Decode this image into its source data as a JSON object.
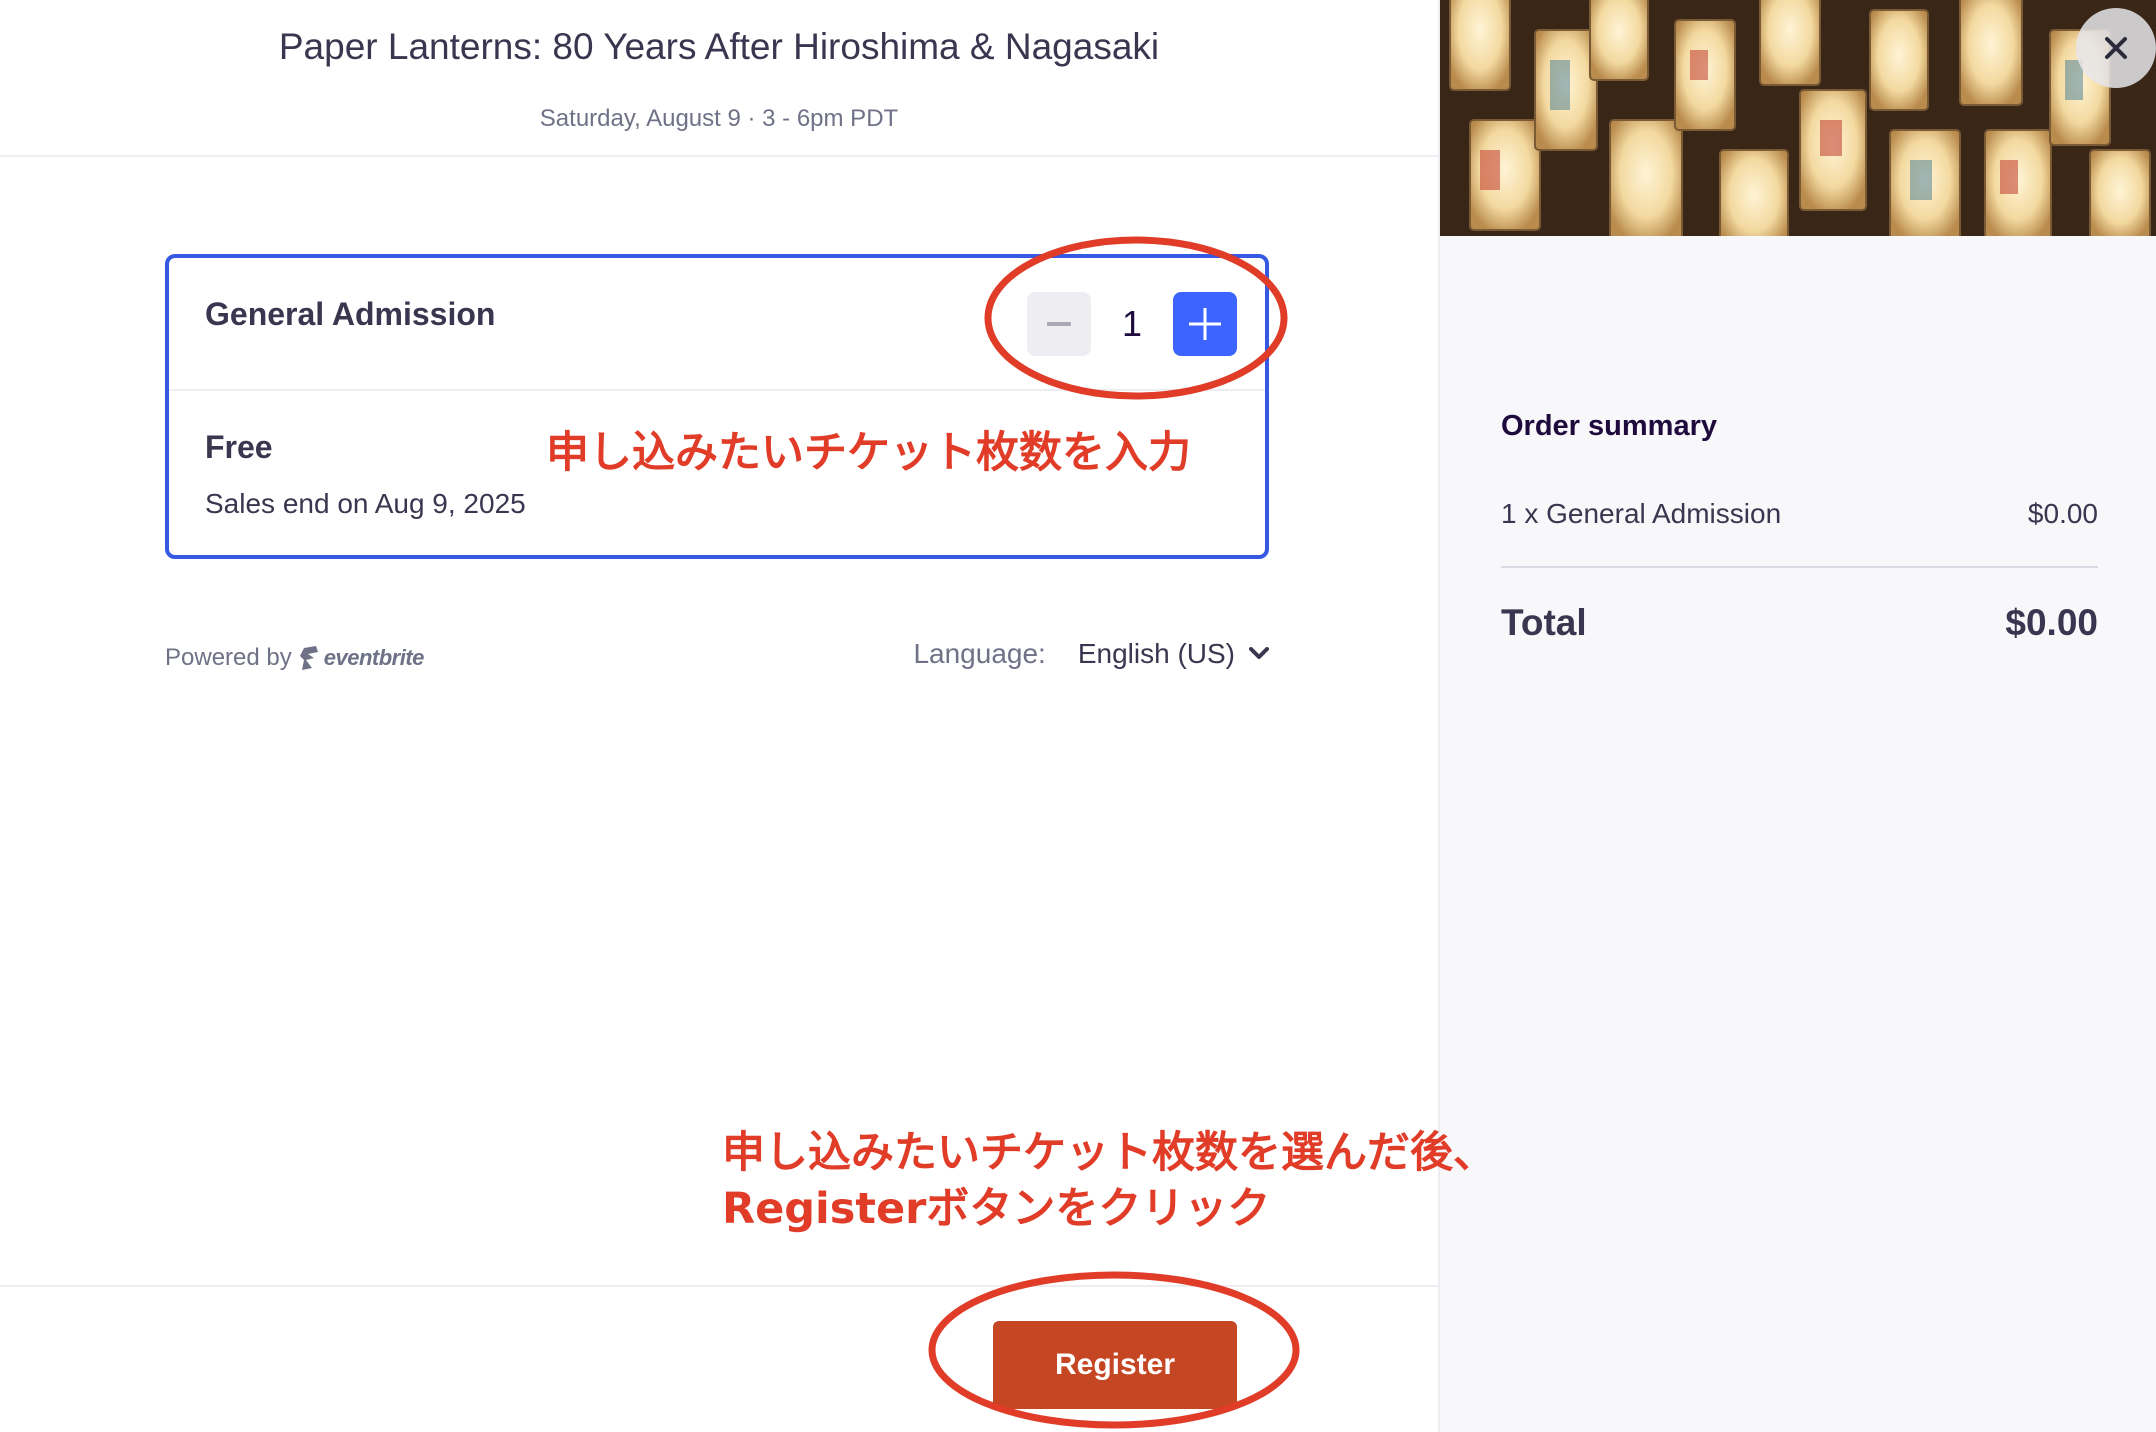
{
  "event": {
    "title": "Paper Lanterns: 80 Years After Hiroshima & Nagasaki",
    "date": "Saturday, August 9 · 3 - 6pm PDT"
  },
  "ticket": {
    "name": "General Admission",
    "price": "Free",
    "sales_end": "Sales end on Aug 9, 2025",
    "quantity": "1"
  },
  "footer": {
    "powered_by": "Powered by",
    "brand": "eventbrite",
    "language_label": "Language:",
    "language_value": "English (US)"
  },
  "actions": {
    "register_label": "Register"
  },
  "summary": {
    "title": "Order summary",
    "line_item": "1 x General Admission",
    "line_price": "$0.00",
    "total_label": "Total",
    "total_value": "$0.00"
  },
  "annotations": {
    "quantity_hint": "申し込みたいチケット枚数を入力",
    "register_hint_line1": "申し込みたいチケット枚数を選んだ後、",
    "register_hint_line2": "Registerボタンをクリック"
  },
  "colors": {
    "accent_blue": "#3d64ff",
    "register_orange": "#c54622",
    "annotation_red": "#e03c28"
  },
  "icons": {
    "minus": "minus-icon",
    "plus": "plus-icon",
    "chevron": "chevron-down-icon",
    "close": "close-icon",
    "brand": "eventbrite-logo-icon"
  }
}
